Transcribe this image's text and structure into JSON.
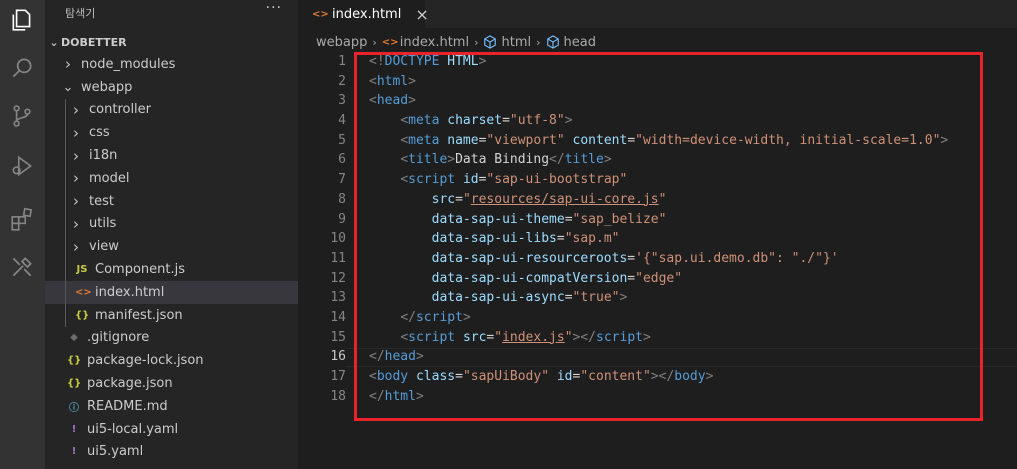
{
  "activity_bar": {
    "icons": [
      "explorer-icon",
      "search-icon",
      "source-control-icon",
      "run-debug-icon",
      "extensions-icon",
      "tools-icon"
    ]
  },
  "explorer": {
    "title": "탐색기",
    "more": "···",
    "root": "DOBETTER",
    "items": [
      {
        "label": "node_modules",
        "type": "folder",
        "depth": 1,
        "expanded": false
      },
      {
        "label": "webapp",
        "type": "folder",
        "depth": 1,
        "expanded": true
      },
      {
        "label": "controller",
        "type": "folder",
        "depth": 2,
        "expanded": false
      },
      {
        "label": "css",
        "type": "folder",
        "depth": 2,
        "expanded": false
      },
      {
        "label": "i18n",
        "type": "folder",
        "depth": 2,
        "expanded": false
      },
      {
        "label": "model",
        "type": "folder",
        "depth": 2,
        "expanded": false
      },
      {
        "label": "test",
        "type": "folder",
        "depth": 2,
        "expanded": false
      },
      {
        "label": "utils",
        "type": "folder",
        "depth": 2,
        "expanded": false
      },
      {
        "label": "view",
        "type": "folder",
        "depth": 2,
        "expanded": false
      },
      {
        "label": "Component.js",
        "type": "js",
        "icon": "JS",
        "depth": 2
      },
      {
        "label": "index.html",
        "type": "html",
        "icon": "<>",
        "depth": 2,
        "selected": true
      },
      {
        "label": "manifest.json",
        "type": "json",
        "icon": "{}",
        "depth": 2
      },
      {
        "label": ".gitignore",
        "type": "git",
        "icon": "◆",
        "depth": 1
      },
      {
        "label": "package-lock.json",
        "type": "json",
        "icon": "{}",
        "depth": 1
      },
      {
        "label": "package.json",
        "type": "json",
        "icon": "{}",
        "depth": 1
      },
      {
        "label": "README.md",
        "type": "info",
        "icon": "ⓘ",
        "depth": 1
      },
      {
        "label": "ui5-local.yaml",
        "type": "yaml",
        "icon": "!",
        "depth": 1
      },
      {
        "label": "ui5.yaml",
        "type": "yaml",
        "icon": "!",
        "depth": 1
      }
    ]
  },
  "tab": {
    "icon": "<>",
    "label": "index.html",
    "close": "×"
  },
  "breadcrumb": [
    "webapp",
    "index.html",
    "html",
    "head"
  ],
  "editor": {
    "active_line": 16,
    "line_numbers": [
      "1",
      "2",
      "3",
      "4",
      "5",
      "6",
      "7",
      "8",
      "9",
      "10",
      "11",
      "12",
      "13",
      "14",
      "15",
      "16",
      "17",
      "18"
    ],
    "lines": [
      [
        [
          "t",
          "<!"
        ],
        [
          "tn",
          "DOCTYPE"
        ],
        [
          "tx",
          " "
        ],
        [
          "an",
          "HTML"
        ],
        [
          "t",
          ">"
        ]
      ],
      [
        [
          "t",
          "<"
        ],
        [
          "tn",
          "html"
        ],
        [
          "t",
          ">"
        ]
      ],
      [
        [
          "t",
          "<"
        ],
        [
          "tn",
          "head"
        ],
        [
          "t",
          ">"
        ]
      ],
      [
        [
          "tx",
          "    "
        ],
        [
          "t",
          "<"
        ],
        [
          "tn",
          "meta"
        ],
        [
          "tx",
          " "
        ],
        [
          "an",
          "charset"
        ],
        [
          "tx",
          "="
        ],
        [
          "av",
          "\"utf-8\""
        ],
        [
          "t",
          ">"
        ]
      ],
      [
        [
          "tx",
          "    "
        ],
        [
          "t",
          "<"
        ],
        [
          "tn",
          "meta"
        ],
        [
          "tx",
          " "
        ],
        [
          "an",
          "name"
        ],
        [
          "tx",
          "="
        ],
        [
          "av",
          "\"viewport\""
        ],
        [
          "tx",
          " "
        ],
        [
          "an",
          "content"
        ],
        [
          "tx",
          "="
        ],
        [
          "av",
          "\"width=device-width, initial-scale=1.0\""
        ],
        [
          "t",
          ">"
        ]
      ],
      [
        [
          "tx",
          "    "
        ],
        [
          "t",
          "<"
        ],
        [
          "tn",
          "title"
        ],
        [
          "t",
          ">"
        ],
        [
          "tx",
          "Data Binding"
        ],
        [
          "t",
          "</"
        ],
        [
          "tn",
          "title"
        ],
        [
          "t",
          ">"
        ]
      ],
      [
        [
          "tx",
          "    "
        ],
        [
          "t",
          "<"
        ],
        [
          "tn",
          "script"
        ],
        [
          "tx",
          " "
        ],
        [
          "an",
          "id"
        ],
        [
          "tx",
          "="
        ],
        [
          "av",
          "\"sap-ui-bootstrap\""
        ]
      ],
      [
        [
          "tx",
          "        "
        ],
        [
          "an",
          "src"
        ],
        [
          "tx",
          "="
        ],
        [
          "av",
          "\""
        ],
        [
          "avl",
          "resources/sap-ui-core.js"
        ],
        [
          "av",
          "\""
        ]
      ],
      [
        [
          "tx",
          "        "
        ],
        [
          "an",
          "data-sap-ui-theme"
        ],
        [
          "tx",
          "="
        ],
        [
          "av",
          "\"sap_belize\""
        ]
      ],
      [
        [
          "tx",
          "        "
        ],
        [
          "an",
          "data-sap-ui-libs"
        ],
        [
          "tx",
          "="
        ],
        [
          "av",
          "\"sap.m\""
        ]
      ],
      [
        [
          "tx",
          "        "
        ],
        [
          "an",
          "data-sap-ui-resourceroots"
        ],
        [
          "tx",
          "="
        ],
        [
          "av",
          "'{\"sap.ui.demo.db\": \"./\"}'"
        ]
      ],
      [
        [
          "tx",
          "        "
        ],
        [
          "an",
          "data-sap-ui-compatVersion"
        ],
        [
          "tx",
          "="
        ],
        [
          "av",
          "\"edge\""
        ]
      ],
      [
        [
          "tx",
          "        "
        ],
        [
          "an",
          "data-sap-ui-async"
        ],
        [
          "tx",
          "="
        ],
        [
          "av",
          "\"true\""
        ],
        [
          "t",
          ">"
        ]
      ],
      [
        [
          "tx",
          "    "
        ],
        [
          "t",
          "</"
        ],
        [
          "tn",
          "script"
        ],
        [
          "t",
          ">"
        ]
      ],
      [
        [
          "tx",
          "    "
        ],
        [
          "t",
          "<"
        ],
        [
          "tn",
          "script"
        ],
        [
          "tx",
          " "
        ],
        [
          "an",
          "src"
        ],
        [
          "tx",
          "="
        ],
        [
          "av",
          "\""
        ],
        [
          "avl",
          "index.js"
        ],
        [
          "av",
          "\""
        ],
        [
          "t",
          "></"
        ],
        [
          "tn",
          "script"
        ],
        [
          "t",
          ">"
        ]
      ],
      [
        [
          "t",
          "</"
        ],
        [
          "tn",
          "head"
        ],
        [
          "t",
          ">"
        ]
      ],
      [
        [
          "t",
          "<"
        ],
        [
          "tn",
          "body"
        ],
        [
          "tx",
          " "
        ],
        [
          "an",
          "class"
        ],
        [
          "tx",
          "="
        ],
        [
          "av",
          "\"sapUiBody\""
        ],
        [
          "tx",
          " "
        ],
        [
          "an",
          "id"
        ],
        [
          "tx",
          "="
        ],
        [
          "av",
          "\"content\""
        ],
        [
          "t",
          "></"
        ],
        [
          "tn",
          "body"
        ],
        [
          "t",
          ">"
        ]
      ],
      [
        [
          "t",
          "</"
        ],
        [
          "tn",
          "html"
        ],
        [
          "t",
          ">"
        ]
      ]
    ]
  },
  "colors": {
    "highlight_box": "#e8232a",
    "activity_bar": "#333333",
    "sidebar": "#252526",
    "editor": "#1e1e1e"
  }
}
